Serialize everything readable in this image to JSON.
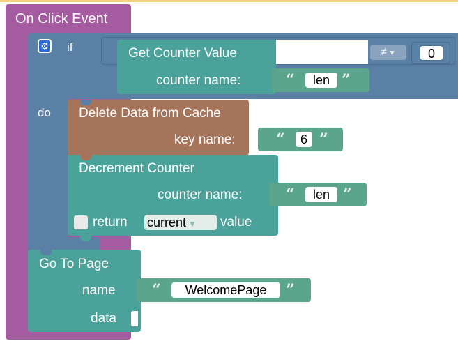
{
  "colors": {
    "event": "#a55b9f",
    "control": "#5b80a5",
    "teal": "#4aa29a",
    "cache": "#a5745b",
    "text_block": "#5ba58c"
  },
  "event": {
    "label": "On Click Event"
  },
  "if_block": {
    "if_label": "if",
    "do_label": "do",
    "gear_icon": "gear-icon"
  },
  "compare": {
    "operator": "≠",
    "value": "0"
  },
  "get_counter": {
    "title": "Get Counter Value",
    "param_label": "counter name:",
    "value": "len"
  },
  "delete_cache": {
    "title": "Delete Data from Cache",
    "param_label": "key name:",
    "value": "6"
  },
  "decrement": {
    "title": "Decrement Counter",
    "param_label": "counter name:",
    "value": "len",
    "return_label": "return",
    "return_option": "current",
    "value_label": "value"
  },
  "go_to_page": {
    "title": "Go To Page",
    "name_label": "name",
    "name_value": "WelcomePage",
    "data_label": "data"
  },
  "quotes": {
    "open": "“",
    "close": "”"
  }
}
